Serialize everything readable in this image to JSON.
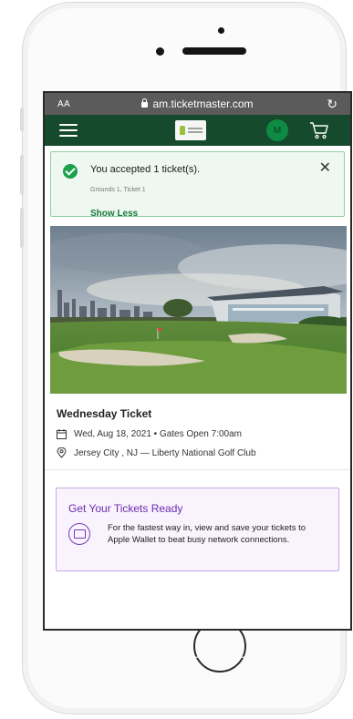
{
  "browser": {
    "text_size_label": "AA",
    "url": "am.ticketmaster.com",
    "reload_icon": "reload-icon"
  },
  "navbar": {
    "avatar_initial": "M",
    "brand_color": "#154a2c"
  },
  "alert": {
    "title": "You accepted 1 ticket(s).",
    "detail": "Grounds 1, Ticket 1",
    "toggle_label": "Show Less",
    "accent": "#1aa14a"
  },
  "event": {
    "title": "Wednesday Ticket",
    "date_line": "Wed, Aug 18, 2021 • Gates Open 7:00am",
    "venue_line": "Jersey City , NJ — Liberty National Golf Club"
  },
  "tickets_ready": {
    "title": "Get Your Tickets Ready",
    "body": "For the fastest way in, view and save your tickets to Apple Wallet to beat busy network connections.",
    "accent": "#6a2bb0"
  }
}
